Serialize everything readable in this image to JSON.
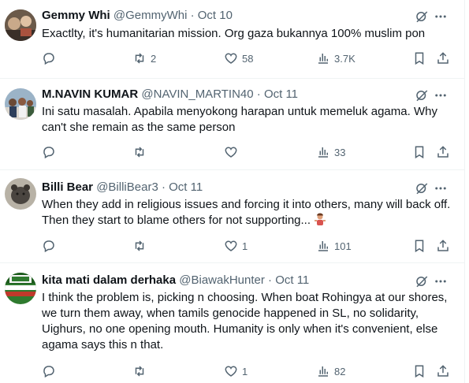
{
  "tweets": [
    {
      "name": "Gemmy Whi",
      "handle": "@GemmyWhi",
      "sep": "·",
      "date": "Oct 10",
      "text": "Exactlty, it's humanitarian mission. Org gaza bukannya 100% muslim pon",
      "reply_count": "",
      "retweet_count": "2",
      "like_count": "58",
      "view_count": "3.7K"
    },
    {
      "name": "M.NAVIN KUMAR",
      "handle": "@NAVIN_MARTIN40",
      "sep": "·",
      "date": "Oct 11",
      "text": "Ini satu masalah. Apabila menyokong harapan untuk  memeluk agama. Why can't she remain as the same person",
      "reply_count": "",
      "retweet_count": "",
      "like_count": "",
      "view_count": "33"
    },
    {
      "name": "Billi Bear",
      "handle": "@BilliBear3",
      "sep": "·",
      "date": "Oct 11",
      "text": "When they add in religious issues and forcing it into others, many will back off. Then they start to blame others for not supporting...",
      "reply_count": "",
      "retweet_count": "",
      "like_count": "1",
      "view_count": "101"
    },
    {
      "name": "kita mati dalam derhaka",
      "handle": "@BiawakHunter",
      "sep": "·",
      "date": "Oct 11",
      "text": "I think the problem is, picking n choosing. When boat Rohingya at our shores, we turn them away, when tamils genocide happened in SL, no solidarity, Uighurs, no one opening mouth. Humanity is only when it's convenient, else  agama says this n that.",
      "reply_count": "",
      "retweet_count": "",
      "like_count": "1",
      "view_count": "82"
    }
  ],
  "icons": {
    "reply": "reply-icon",
    "retweet": "retweet-icon",
    "like": "like-icon",
    "views": "views-icon",
    "bookmark": "bookmark-icon",
    "share": "share-icon",
    "grok": "grok-icon",
    "more": "more-icon",
    "emoji": "person-shrugging-emoji"
  },
  "colors": {
    "text": "#0f1419",
    "secondary": "#536471",
    "divider": "#eff3f4",
    "background": "#ffffff"
  }
}
